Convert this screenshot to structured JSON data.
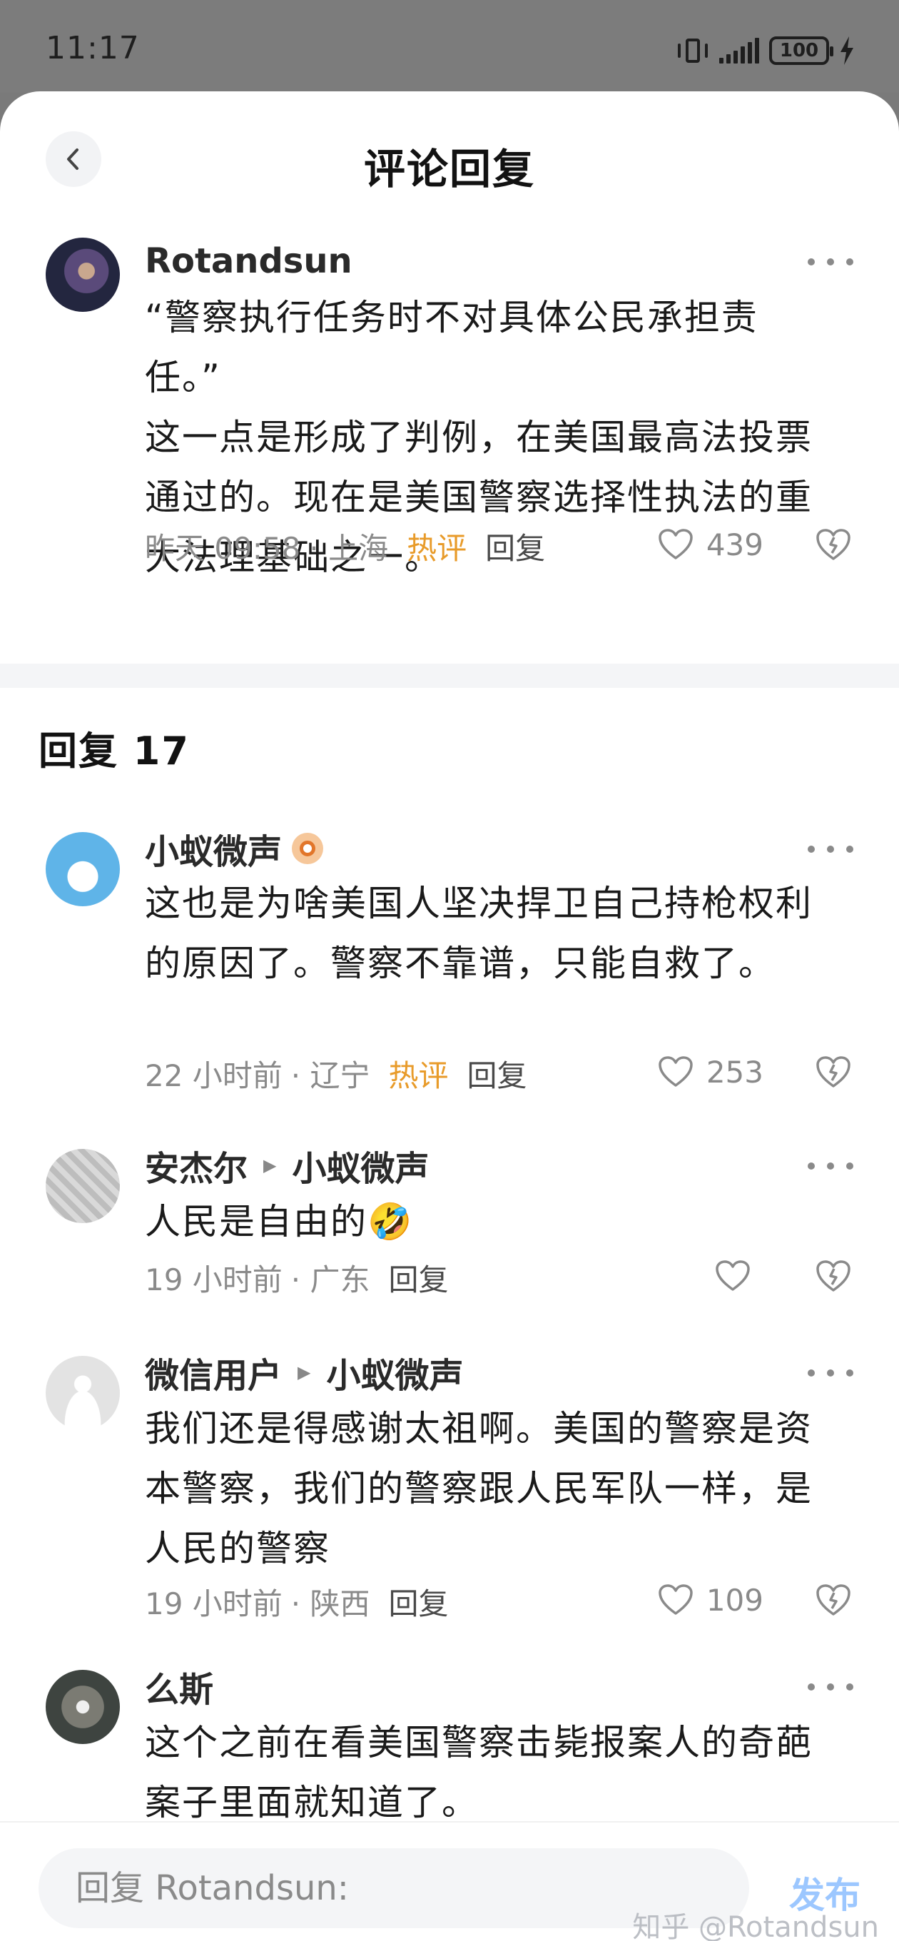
{
  "status_bar": {
    "time": "11:17",
    "battery": "100"
  },
  "header": {
    "title": "评论回复"
  },
  "main_comment": {
    "author": "Rotandsun",
    "text": "“警察执行任务时不对具体公民承担责任。”\n这一点是形成了判例，在美国最高法投票通过的。现在是美国警察选择性执法的重大法理基础之一。",
    "time": "昨天 09:58",
    "location": "· 上海",
    "hot_label": "热评",
    "reply_label": "回复",
    "likes": "439"
  },
  "replies_heading": "回复 17",
  "replies": [
    {
      "author": "小蚁微声",
      "reply_to": "",
      "text": "这也是为啥美国人坚决捍卫自己持枪权利的原因了。警察不靠谱，只能自救了。",
      "time": "22 小时前",
      "location": "· 辽宁",
      "hot_label": "热评",
      "reply_label": "回复",
      "likes": "253"
    },
    {
      "author": "安杰尔",
      "reply_to": "小蚁微声",
      "text": "人民是自由的🤣",
      "time": "19 小时前",
      "location": "· 广东",
      "reply_label": "回复",
      "likes": ""
    },
    {
      "author": "微信用户",
      "reply_to": "小蚁微声",
      "text": "我们还是得感谢太祖啊。美国的警察是资本警察，我们的警察跟人民军队一样，是人民的警察",
      "time": "19 小时前",
      "location": "· 陕西",
      "reply_label": "回复",
      "likes": "109"
    },
    {
      "author": "么斯",
      "reply_to": "",
      "text": "这个之前在看美国警察击毙报案人的奇葩案子里面就知道了。"
    }
  ],
  "bottom_bar": {
    "input_placeholder": "回复 Rotandsun:",
    "publish_label": "发布",
    "watermark": "知乎 @Rotandsun"
  },
  "colors": {
    "hot": "#e89b2a",
    "publish_disabled": "#9cc7ff",
    "meta": "#8a8a8a"
  }
}
